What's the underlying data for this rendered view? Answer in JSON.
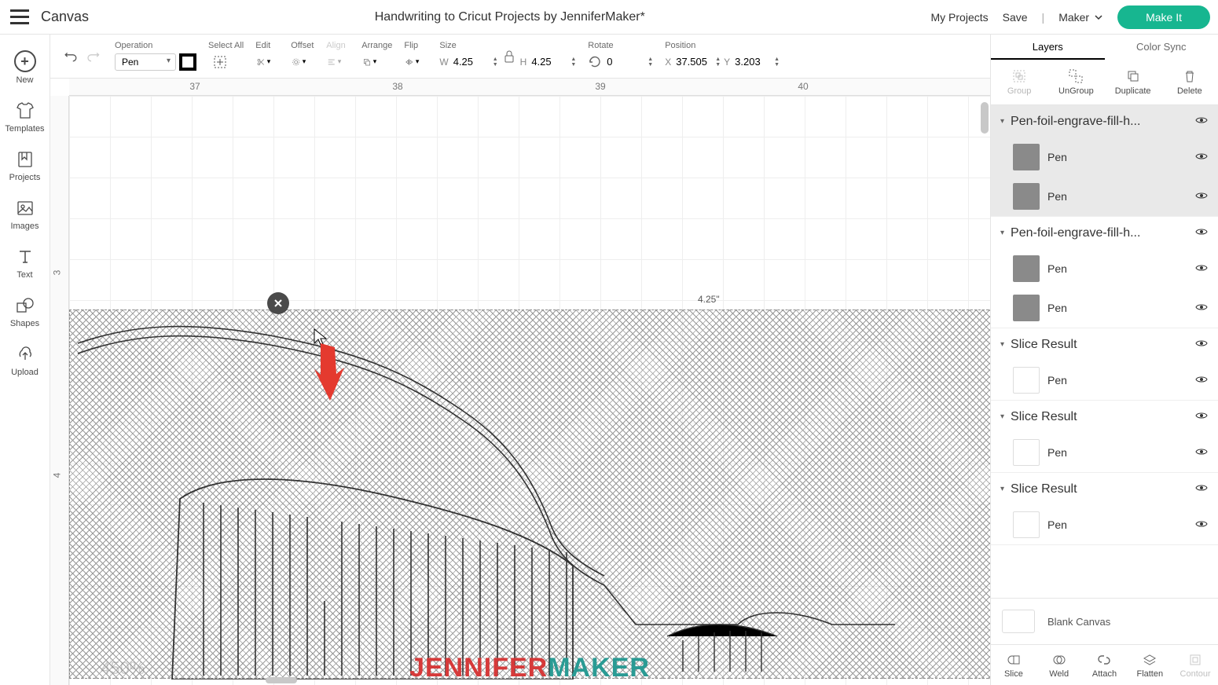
{
  "header": {
    "app": "Canvas",
    "title": "Handwriting to Cricut Projects by JenniferMaker*",
    "my_projects": "My Projects",
    "save": "Save",
    "machine": "Maker",
    "make_it": "Make It"
  },
  "left_nav": {
    "new": "New",
    "templates": "Templates",
    "projects": "Projects",
    "images": "Images",
    "text": "Text",
    "shapes": "Shapes",
    "upload": "Upload"
  },
  "toolbar": {
    "operation_label": "Operation",
    "operation_value": "Pen",
    "select_all": "Select All",
    "edit": "Edit",
    "offset": "Offset",
    "align": "Align",
    "arrange": "Arrange",
    "flip": "Flip",
    "size_label": "Size",
    "size_w_letter": "W",
    "size_w": "4.25",
    "size_h_letter": "H",
    "size_h": "4.25",
    "rotate_label": "Rotate",
    "rotate_val": "0",
    "position_label": "Position",
    "pos_x_letter": "X",
    "pos_x": "37.505",
    "pos_y_letter": "Y",
    "pos_y": "3.203"
  },
  "canvas": {
    "ruler_h": [
      "37",
      "38",
      "39",
      "40"
    ],
    "ruler_v": [
      "3",
      "4"
    ],
    "dimension": "4.25\"",
    "zoom": "450%",
    "watermark1": "JENNIFER",
    "watermark2": "MAKER"
  },
  "right": {
    "tab_layers": "Layers",
    "tab_colorsync": "Color Sync",
    "act_group": "Group",
    "act_ungroup": "UnGroup",
    "act_duplicate": "Duplicate",
    "act_delete": "Delete",
    "groups": [
      {
        "title": "Pen-foil-engrave-fill-h...",
        "children": [
          "Pen",
          "Pen"
        ],
        "selected": true,
        "swatch": "gray"
      },
      {
        "title": "Pen-foil-engrave-fill-h...",
        "children": [
          "Pen",
          "Pen"
        ],
        "selected": false,
        "swatch": "gray"
      },
      {
        "title": "Slice Result",
        "children": [
          "Pen"
        ],
        "selected": false,
        "swatch": "white"
      },
      {
        "title": "Slice Result",
        "children": [
          "Pen"
        ],
        "selected": false,
        "swatch": "white"
      },
      {
        "title": "Slice Result",
        "children": [
          "Pen"
        ],
        "selected": false,
        "swatch": "white"
      }
    ],
    "blank_canvas": "Blank Canvas",
    "bot_slice": "Slice",
    "bot_weld": "Weld",
    "bot_attach": "Attach",
    "bot_flatten": "Flatten",
    "bot_contour": "Contour"
  }
}
